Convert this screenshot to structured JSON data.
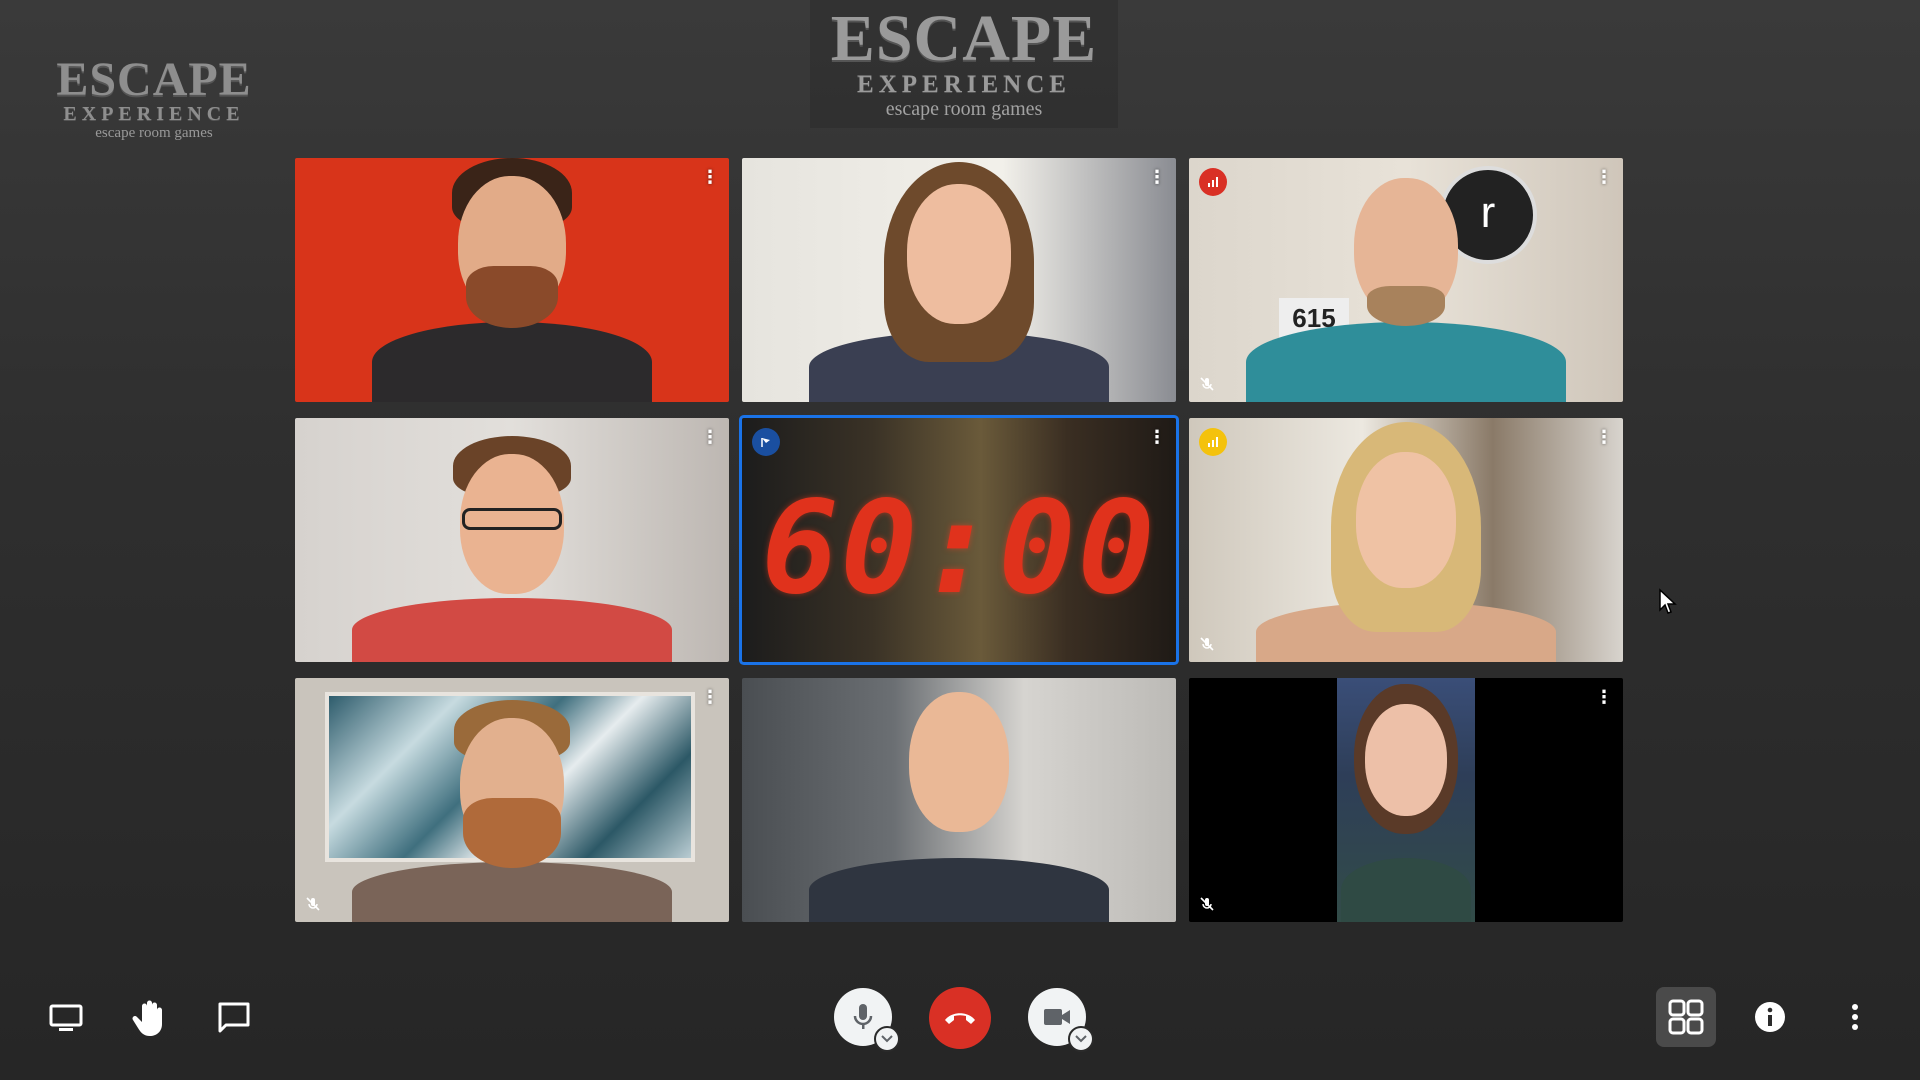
{
  "logo_left": {
    "line1": "ESCAPE",
    "line2": "EXPERIENCE",
    "line3": "escape room games"
  },
  "logo_center": {
    "line1": "ESCAPE",
    "line2": "EXPERIENCE",
    "line3": "escape room games"
  },
  "timer": {
    "display": "60:00"
  },
  "tiles": [
    {
      "name": "participant-1",
      "muted": false,
      "bg": "#d8341a"
    },
    {
      "name": "participant-2",
      "muted": false,
      "bg": "#e8e6e0"
    },
    {
      "name": "participant-3",
      "muted": true,
      "speaking": true,
      "speaking_color": "#d93025",
      "bg": "#d8d2c8",
      "wall_number": "615",
      "wall_letter": "r"
    },
    {
      "name": "participant-4",
      "muted": false,
      "bg": "#cfcac6"
    },
    {
      "name": "participant-5-timer",
      "muted": false,
      "pinned": true
    },
    {
      "name": "participant-6",
      "muted": true,
      "speaking": true,
      "speaking_color": "#f4c20d",
      "bg": "#d9d4cc"
    },
    {
      "name": "participant-7",
      "muted": true,
      "bg": "#c9c4bc"
    },
    {
      "name": "participant-8",
      "muted": false,
      "bg": "#6b7075"
    },
    {
      "name": "participant-9",
      "muted": true,
      "bg": "#000000"
    }
  ],
  "controls": {
    "left": [
      "present-screen",
      "raise-hand",
      "chat"
    ],
    "center": [
      "microphone",
      "leave-call",
      "camera"
    ],
    "right": [
      "tile-layout",
      "meeting-info",
      "more-options"
    ]
  }
}
